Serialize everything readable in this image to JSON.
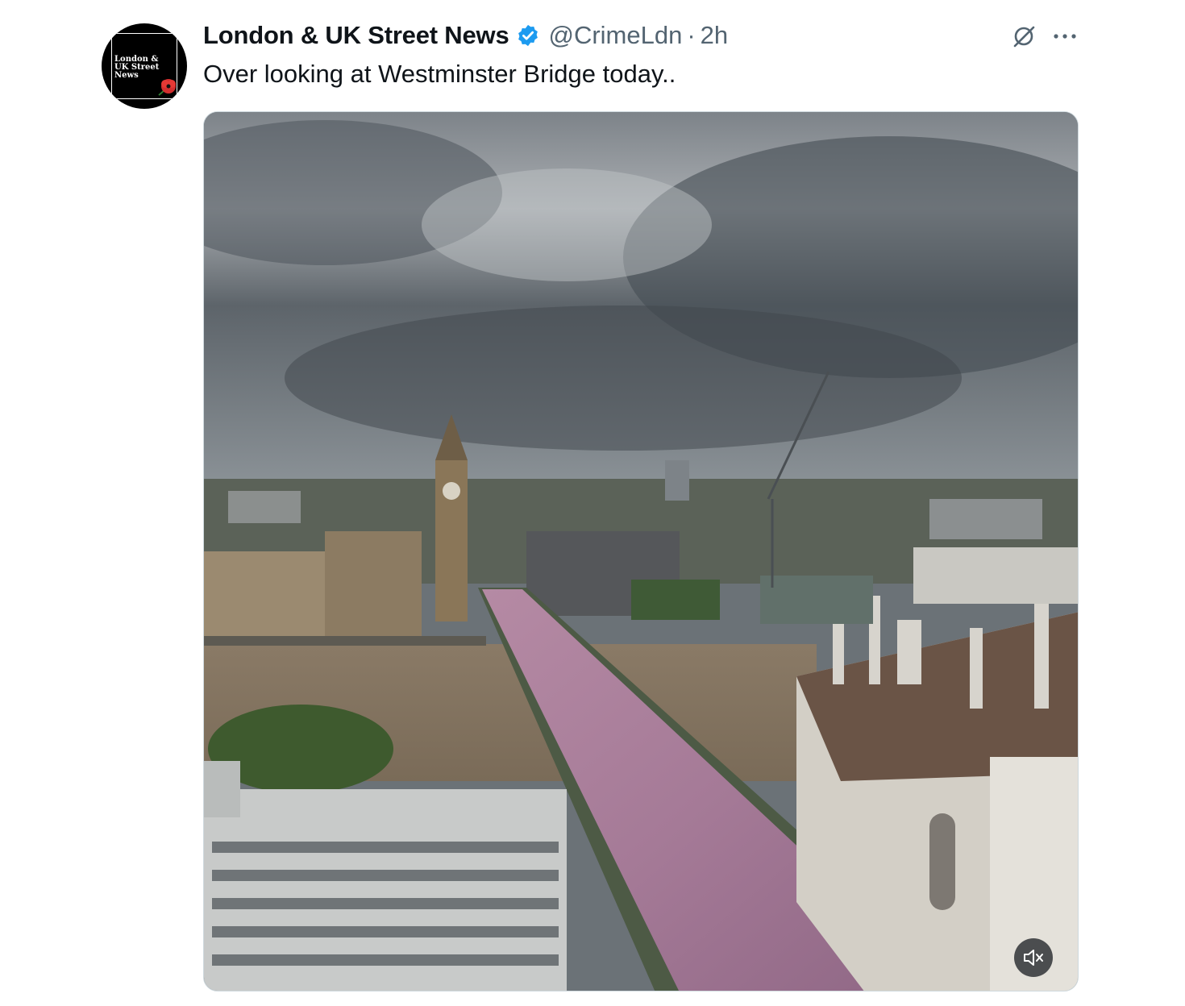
{
  "author": {
    "display_name": "London & UK Street News",
    "handle": "@CrimeLdn",
    "separator": "·",
    "timestamp": "2h",
    "verified": true,
    "avatar_text": [
      "London &",
      "UK Street",
      "News"
    ]
  },
  "tweet": {
    "text": "Over looking at Westminster Bridge today.."
  },
  "actions": {
    "grok_icon": "grok-icon",
    "more_icon": "more-horizontal-icon"
  },
  "media": {
    "type": "video",
    "mute_icon": "volume-muted-icon"
  },
  "colors": {
    "text_primary": "#0f1419",
    "text_secondary": "#536471",
    "verified_blue": "#1d9bf0",
    "border": "#cfd9de"
  }
}
